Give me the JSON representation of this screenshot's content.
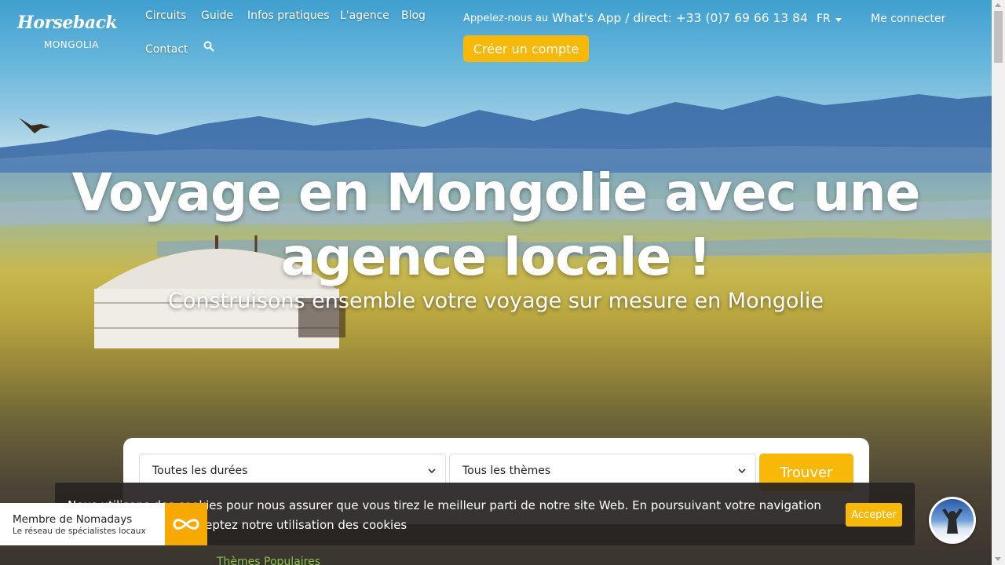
{
  "brand": {
    "logo_line1": "Horseback",
    "logo_line2": "MONGOLIA"
  },
  "nav": {
    "items": [
      {
        "label": "Circuits"
      },
      {
        "label": "Guide"
      },
      {
        "label": "Infos pratiques"
      },
      {
        "label": "L'agence"
      },
      {
        "label": "Blog"
      },
      {
        "label": "Contact"
      }
    ],
    "search_icon": "search-icon"
  },
  "header": {
    "call_label": "Appelez-nous au",
    "phone": "What's App / direct: +33 (0)7 69 66 13 84",
    "language": "FR",
    "login": "Me connecter",
    "create_account": "Créer un compte"
  },
  "hero": {
    "title": "Voyage en Mongolie avec une agence locale !",
    "subtitle": "Construisons ensemble votre voyage sur mesure en Mongolie"
  },
  "search": {
    "duration_selected": "Toutes les durées",
    "theme_selected": "Tous les thèmes",
    "submit": "Trouver"
  },
  "cookie": {
    "text": "Nous utilisons des cookies pour nous assurer que vous tirez le meilleur parti de notre site Web. En poursuivant votre navigation sur notre site, vous acceptez notre utilisation des cookies",
    "accept": "Accepter"
  },
  "badge": {
    "title": "Membre de Nomadays",
    "subtitle": "Le réseau de spécialistes locaux"
  },
  "section_peek": "Thèmes Populaires",
  "colors": {
    "accent": "#f7b808",
    "cookie_bg": "#282422"
  }
}
